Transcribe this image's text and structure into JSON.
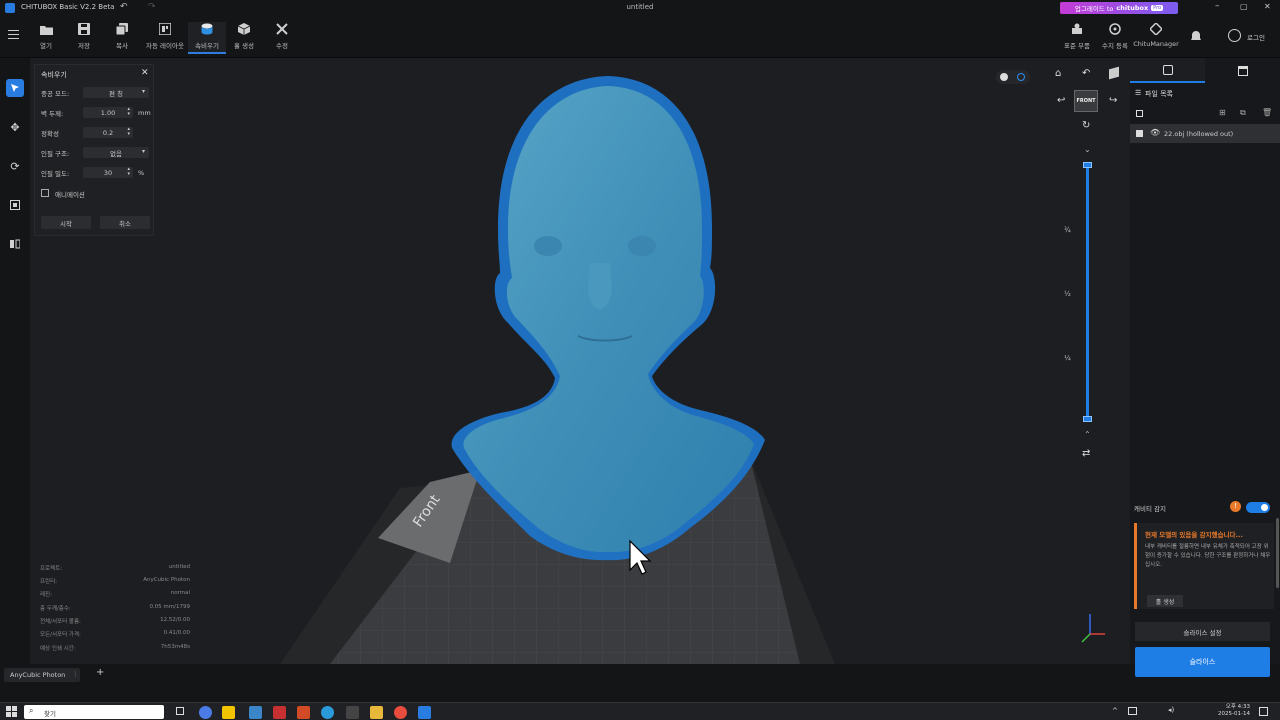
{
  "titlebar": {
    "app_title": "CHITUBOX Basic V2.2 Beta",
    "doc_title": "untitled",
    "upgrade_text": "업그레이드 to",
    "upgrade_brand": "chitubox",
    "upgrade_badge": "Pro"
  },
  "toolbar": {
    "items": [
      {
        "label": "열기",
        "icon": "folder-icon"
      },
      {
        "label": "저장",
        "icon": "save-icon"
      },
      {
        "label": "복사",
        "icon": "copy-icon"
      },
      {
        "label": "자동 레이아웃",
        "icon": "layout-icon"
      },
      {
        "label": "속비우기",
        "icon": "hollow-icon"
      },
      {
        "label": "홀 생성",
        "icon": "hole-icon"
      },
      {
        "label": "수정",
        "icon": "repair-icon"
      }
    ],
    "right_items": [
      {
        "label": "표준 부품",
        "icon": "parts-icon"
      },
      {
        "label": "수지 등록",
        "icon": "resin-icon"
      },
      {
        "label": "ChituManager",
        "icon": "manager-icon"
      }
    ],
    "login_label": "로그인"
  },
  "hollow_panel": {
    "title": "속비우기",
    "mode_label": "중공 모드:",
    "mode_value": "편 칭",
    "wall_label": "벽 두께:",
    "wall_value": "1.00",
    "wall_unit": "mm",
    "precision_label": "정확성",
    "precision_value": "0.2",
    "infill_label": "인필 구조:",
    "infill_value": "없음",
    "density_label": "인필 밀도:",
    "density_value": "30",
    "density_unit": "%",
    "animation_label": "애니메이션",
    "start_label": "시작",
    "cancel_label": "취소"
  },
  "info": [
    {
      "k": "프로젝트:",
      "v": "untitled"
    },
    {
      "k": "프린터:",
      "v": "AnyCubic Photon"
    },
    {
      "k": "레진:",
      "v": "normal"
    },
    {
      "k": "층 두께/층수:",
      "v": "0.05 mm/1799"
    },
    {
      "k": "전체/서포터 볼륨:",
      "v": "12.52/0.00"
    },
    {
      "k": "모든/서포터 가격:",
      "v": "0.41/0.00"
    },
    {
      "k": "예상 인쇄 시간:",
      "v": "7h53m48s"
    }
  ],
  "view": {
    "front_label": "FRONT",
    "plate_label": "Front",
    "slider_marks": [
      "¾",
      "½",
      "¼"
    ]
  },
  "files": {
    "title": "파일 목록",
    "items": [
      {
        "name": "22.obj (hollowed out)"
      }
    ]
  },
  "cavity": {
    "title": "캐비티 감지",
    "warning_title": "현재 모델의 있음을 감지했습니다...",
    "warning_body": "내부 캐비티를 절룡하면 내부 유체가 축적되어 고장 위험이 증가할 수 있습니다. 당한 구조를 판정하거나 채우십시오.",
    "hole_button": "홀 생성"
  },
  "slice_settings_label": "슬라이스 설정",
  "slice_label": "슬라이스",
  "printer_tab": "AnyCubic Photon",
  "taskbar": {
    "search_placeholder": "찾기",
    "time": "오후 4:33",
    "date": "2025-01-14"
  },
  "colors": {
    "accent": "#1f7de6",
    "model": "#2f8fd0",
    "warning": "#e8792a",
    "upgrade": "#c43bd6"
  }
}
